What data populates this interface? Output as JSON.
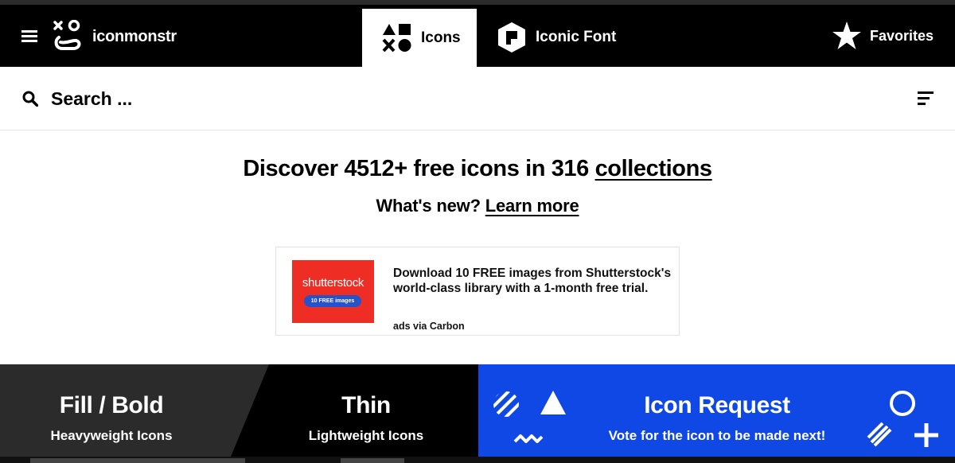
{
  "header": {
    "logo_text": "iconmonstr",
    "tab_icons_label": "Icons",
    "tab_font_label": "Iconic Font",
    "favorites_label": "Favorites"
  },
  "search": {
    "placeholder": "Search ..."
  },
  "hero": {
    "title_prefix": "Discover 4512+ free icons in 316 ",
    "title_link": "collections",
    "sub_prefix": "What's new? ",
    "sub_link": "Learn more"
  },
  "ad": {
    "brand": "shutterstock",
    "pill": "10 FREE images",
    "text": "Download 10 FREE images from Shutterstock's world-class library with a 1-month free trial.",
    "via": "ads via Carbon"
  },
  "panels": {
    "fill_title": "Fill / Bold",
    "fill_sub": "Heavyweight Icons",
    "thin_title": "Thin",
    "thin_sub": "Lightweight Icons",
    "request_title": "Icon Request",
    "request_sub": "Vote for the icon to be made next!"
  },
  "colors": {
    "header_bg": "#000000",
    "request_blue": "#1048e5",
    "fill_panel": "#2b2b2b",
    "ad_red": "#ee2e24"
  },
  "icons": [
    "menu-icon",
    "logo-icon",
    "shapes-icon",
    "iconic-font-icon",
    "star-icon",
    "search-icon",
    "sort-icon"
  ]
}
